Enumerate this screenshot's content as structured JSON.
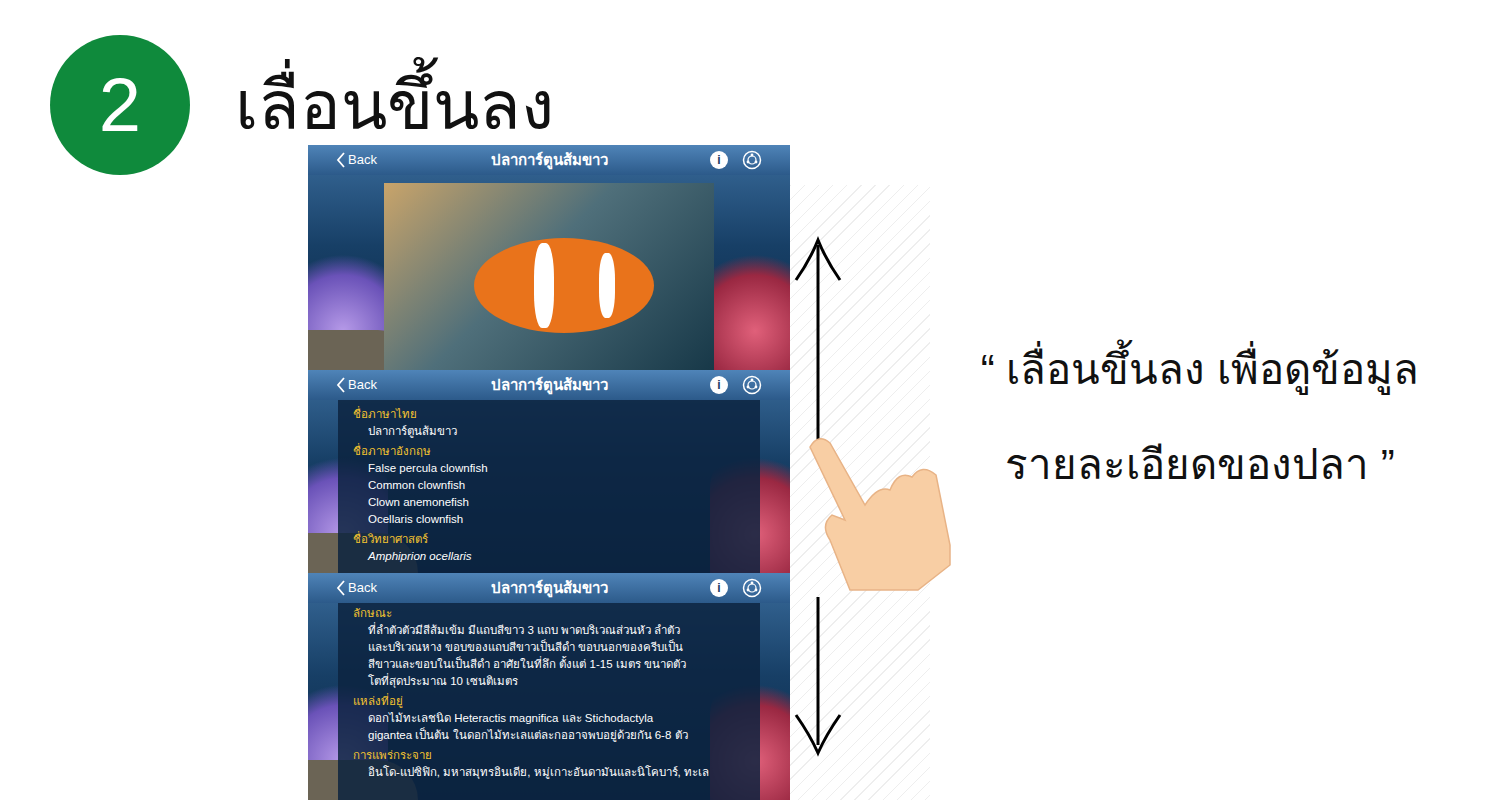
{
  "step": {
    "number": "2",
    "title": "เลื่อนขึ้นลง"
  },
  "caption": [
    "“ เลื่อนขึ้นลง เพื่อดูข้อมูล",
    "รายละเอียดของปลา ”"
  ],
  "screens": [
    {
      "kind": "photo",
      "header": {
        "back": "Back",
        "title": "ปลาการ์ตูนส้มขาว",
        "info": "i"
      },
      "sections": []
    },
    {
      "kind": "details",
      "header": {
        "back": "Back",
        "title": "ปลาการ์ตูนส้มขาว",
        "info": "i"
      },
      "sections": [
        {
          "heading": "ชื่อภาษาไทย",
          "italic": false,
          "lines": [
            "ปลาการ์ตูนส้มขาว"
          ]
        },
        {
          "heading": "ชื่อภาษาอังกฤษ",
          "italic": false,
          "lines": [
            "False percula clownfish",
            "Common clownfish",
            "Clown anemonefish",
            "Ocellaris clownfish"
          ]
        },
        {
          "heading": "ชื่อวิทยาศาสตร์",
          "italic": true,
          "lines": [
            "Amphiprion ocellaris"
          ]
        }
      ]
    },
    {
      "kind": "details",
      "header": {
        "back": "Back",
        "title": "ปลาการ์ตูนส้มขาว",
        "info": "i"
      },
      "sections": [
        {
          "heading": "ลักษณะ",
          "italic": false,
          "lines": [
            "ที่ลำตัวตัวมีสีส้มเข้ม มีแถบสีขาว 3 แถบ พาดบริเวณส่วนหัว ลำตัว",
            "และบริเวณหาง ขอบของแถบสีขาวเป็นสีดำ ขอบนอกของครีบเป็น",
            "สีขาวและขอบในเป็นสีดำ อาศัยในที่ลึก ตั้งแต่ 1-15 เมตร ขนาดตัว",
            "โตที่สุดประมาณ 10 เซนติเมตร"
          ]
        },
        {
          "heading": "แหล่งที่อยู่",
          "italic": false,
          "lines": [
            "ดอกไม้ทะเลชนิด Heteractis magnifica และ Stichodactyla",
            "gigantea เป็นต้น ในดอกไม้ทะเลแต่ละกออาจพบอยู่ด้วยกัน 6-8 ตัว"
          ]
        },
        {
          "heading": "การแพร่กระจาย",
          "italic": false,
          "lines": [
            "อินโด-แปซิฟิก, มหาสมุทรอินเดีย, หมู่เกาะอันดามันและนิโคบาร์, ทะเล"
          ]
        }
      ]
    }
  ]
}
